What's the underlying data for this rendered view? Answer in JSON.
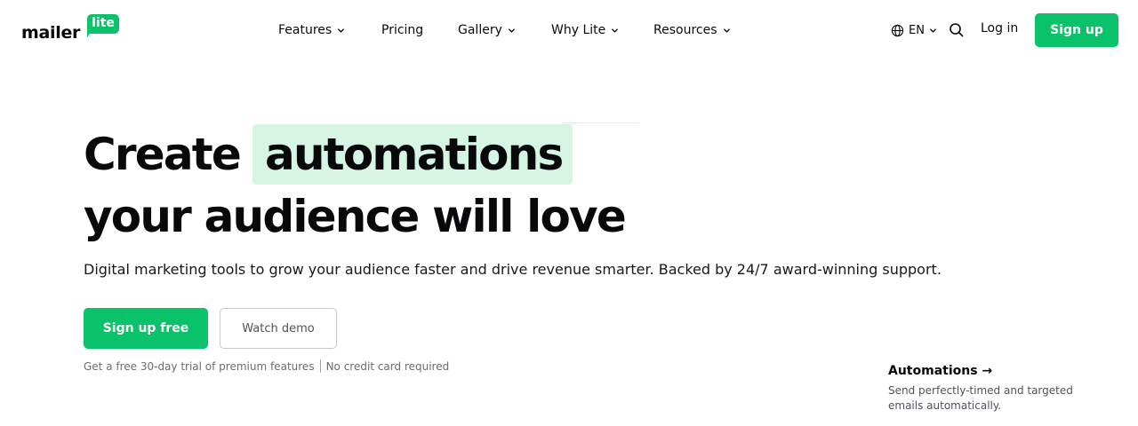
{
  "brand": {
    "word": "mailer",
    "badge": "lite",
    "accent": "#09c269",
    "highlight_bg": "#d6f5e5"
  },
  "nav": {
    "items": [
      {
        "label": "Features",
        "has_dropdown": true
      },
      {
        "label": "Pricing",
        "has_dropdown": false
      },
      {
        "label": "Gallery",
        "has_dropdown": true
      },
      {
        "label": "Why Lite",
        "has_dropdown": true
      },
      {
        "label": "Resources",
        "has_dropdown": true
      }
    ],
    "language": "EN",
    "login_label": "Log in",
    "signup_label": "Sign up"
  },
  "hero": {
    "title_prefix": "Create",
    "title_highlight": "automations",
    "title_line2": "your audience will love",
    "subtitle": "Digital marketing tools to grow your audience faster and drive revenue smarter. Backed by 24/7 award-winning support.",
    "primary_cta": "Sign up free",
    "secondary_cta": "Watch demo",
    "trial_note_1": "Get a free 30-day trial of premium features",
    "trial_note_2": "No credit card required"
  },
  "feature_card": {
    "title": "Automations →",
    "description": "Send perfectly-timed and targeted emails automatically."
  },
  "icons": {
    "language": "globe-icon",
    "search": "search-icon",
    "dropdown": "chevron-down-icon"
  }
}
